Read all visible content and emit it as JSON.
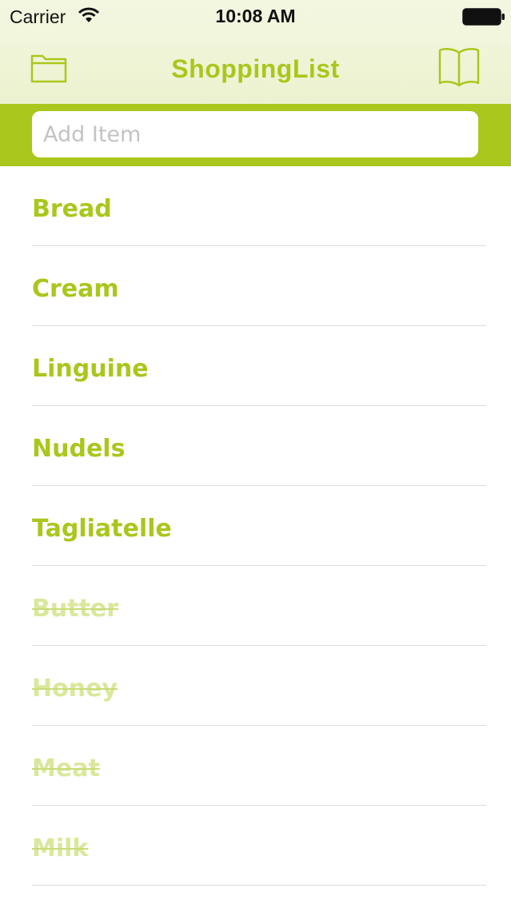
{
  "status_bar": {
    "carrier": "Carrier",
    "time": "10:08 AM"
  },
  "nav": {
    "title": "ShoppingList",
    "left_icon": "folder-icon",
    "right_icon": "book-icon"
  },
  "add_item": {
    "placeholder": "Add Item",
    "value": ""
  },
  "colors": {
    "accent": "#a9c71c",
    "accent_faded": "#d9e89b",
    "nav_background": "#ecf2cf"
  },
  "items": [
    {
      "label": "Bread",
      "done": false
    },
    {
      "label": "Cream",
      "done": false
    },
    {
      "label": "Linguine",
      "done": false
    },
    {
      "label": "Nudels",
      "done": false
    },
    {
      "label": "Tagliatelle",
      "done": false
    },
    {
      "label": "Butter",
      "done": true
    },
    {
      "label": "Honey",
      "done": true
    },
    {
      "label": "Meat",
      "done": true
    },
    {
      "label": "Milk",
      "done": true
    }
  ]
}
